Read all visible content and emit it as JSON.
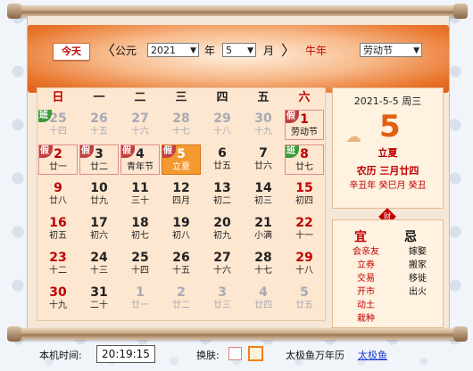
{
  "header": {
    "today_label": "今天",
    "prev_label": "〈",
    "next_label": "〉",
    "era_label": "公元",
    "year_value": "2021",
    "year_suffix": "年",
    "month_value": "5",
    "month_suffix": "月",
    "zodiac_year": "牛年",
    "holiday_select": "劳动节"
  },
  "weekdays": [
    "日",
    "一",
    "二",
    "三",
    "四",
    "五",
    "六"
  ],
  "days": [
    {
      "d": "25",
      "l": "十四",
      "other": true,
      "tag": "班"
    },
    {
      "d": "26",
      "l": "十五",
      "other": true
    },
    {
      "d": "27",
      "l": "十六",
      "other": true
    },
    {
      "d": "28",
      "l": "十七",
      "other": true
    },
    {
      "d": "29",
      "l": "十八",
      "other": true
    },
    {
      "d": "30",
      "l": "十九",
      "other": true
    },
    {
      "d": "1",
      "l": "劳动节",
      "red": true,
      "tag": "假",
      "hol": true,
      "fest": true
    },
    {
      "d": "2",
      "l": "廿一",
      "red": true,
      "tag": "假",
      "hol": true
    },
    {
      "d": "3",
      "l": "廿二",
      "tag": "假",
      "hol": true
    },
    {
      "d": "4",
      "l": "青年节",
      "tag": "假",
      "hol": true
    },
    {
      "d": "5",
      "l": "立夏",
      "tag": "假",
      "selected": true
    },
    {
      "d": "6",
      "l": "廿五"
    },
    {
      "d": "7",
      "l": "廿六"
    },
    {
      "d": "8",
      "l": "廿七",
      "red": true,
      "tag": "班",
      "hol": true
    },
    {
      "d": "9",
      "l": "廿八",
      "red": true
    },
    {
      "d": "10",
      "l": "廿九"
    },
    {
      "d": "11",
      "l": "三十"
    },
    {
      "d": "12",
      "l": "四月"
    },
    {
      "d": "13",
      "l": "初二"
    },
    {
      "d": "14",
      "l": "初三"
    },
    {
      "d": "15",
      "l": "初四",
      "red": true
    },
    {
      "d": "16",
      "l": "初五",
      "red": true
    },
    {
      "d": "17",
      "l": "初六"
    },
    {
      "d": "18",
      "l": "初七"
    },
    {
      "d": "19",
      "l": "初八"
    },
    {
      "d": "20",
      "l": "初九"
    },
    {
      "d": "21",
      "l": "小满"
    },
    {
      "d": "22",
      "l": "十一",
      "red": true
    },
    {
      "d": "23",
      "l": "十二",
      "red": true
    },
    {
      "d": "24",
      "l": "十三"
    },
    {
      "d": "25",
      "l": "十四"
    },
    {
      "d": "26",
      "l": "十五"
    },
    {
      "d": "27",
      "l": "十六"
    },
    {
      "d": "28",
      "l": "十七"
    },
    {
      "d": "29",
      "l": "十八",
      "red": true
    },
    {
      "d": "30",
      "l": "十九",
      "red": true
    },
    {
      "d": "31",
      "l": "二十"
    },
    {
      "d": "1",
      "l": "廿一",
      "other": true
    },
    {
      "d": "2",
      "l": "廿二",
      "other": true
    },
    {
      "d": "3",
      "l": "廿三",
      "other": true
    },
    {
      "d": "4",
      "l": "廿四",
      "other": true
    },
    {
      "d": "5",
      "l": "廿五",
      "other": true
    }
  ],
  "info": {
    "date_line": "2021-5-5  周三",
    "big_day": "5",
    "solar_term": "立夏",
    "lunar_date": "农历  三月廿四",
    "ganzhi": "辛丑年 癸巳月 癸丑",
    "badge": "财"
  },
  "yiji": {
    "yi_title": "宜",
    "ji_title": "忌",
    "yi": [
      "会亲友",
      "立券",
      "交易",
      "开市",
      "动土",
      "栽种"
    ],
    "ji": [
      "嫁娶",
      "搬家",
      "移徙",
      "出火"
    ]
  },
  "footer": {
    "time_label": "本机时间:",
    "time_value": "20:19:15",
    "skin_label": "换肤:",
    "brand": "太极鱼万年历",
    "link": "太极鱼"
  },
  "colors": {
    "accent": "#dd5d19",
    "festival_red": "#c00000",
    "selected": "#f4992f",
    "tag_green": "#3a9a3a",
    "tag_red": "#c04040"
  }
}
